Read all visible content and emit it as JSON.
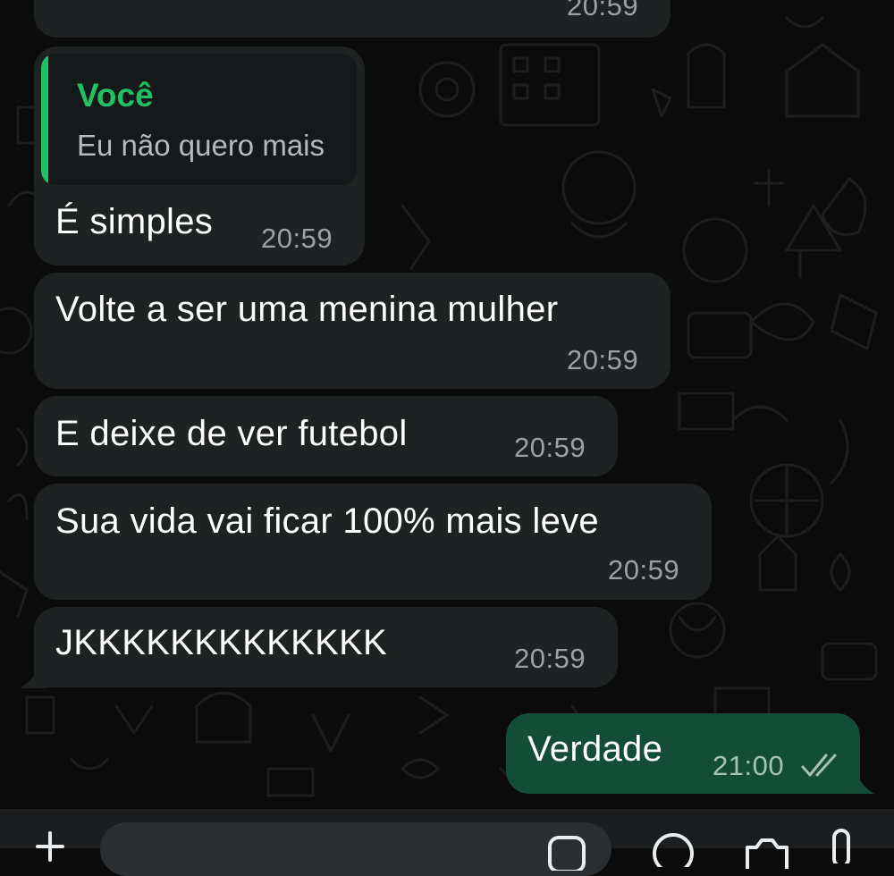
{
  "colors": {
    "incoming_bubble": "#1f2222",
    "outgoing_bubble": "#144d37",
    "quote_accent": "#21c063",
    "timestamp": "#9aa1a3",
    "read_ticks": "#a3c3b4"
  },
  "messages": [
    {
      "text": "",
      "time": "20:59"
    },
    {
      "reply_author": "Você",
      "reply_text": "Eu não quero mais",
      "text": "É simples",
      "time": "20:59"
    },
    {
      "text": "Volte a ser uma menina mulher",
      "time": "20:59"
    },
    {
      "text": "E deixe de ver futebol",
      "time": "20:59"
    },
    {
      "text": "Sua vida vai ficar 100% mais leve",
      "time": "20:59"
    },
    {
      "text": "JKKKKKKKKKKKKK",
      "time": "20:59"
    },
    {
      "text": "Verdade",
      "time": "21:00",
      "status_icon": "double-check-icon"
    }
  ],
  "composer": {
    "icons": [
      "plus-icon",
      "sticker-icon",
      "cash-icon",
      "camera-icon",
      "microphone-icon"
    ]
  }
}
